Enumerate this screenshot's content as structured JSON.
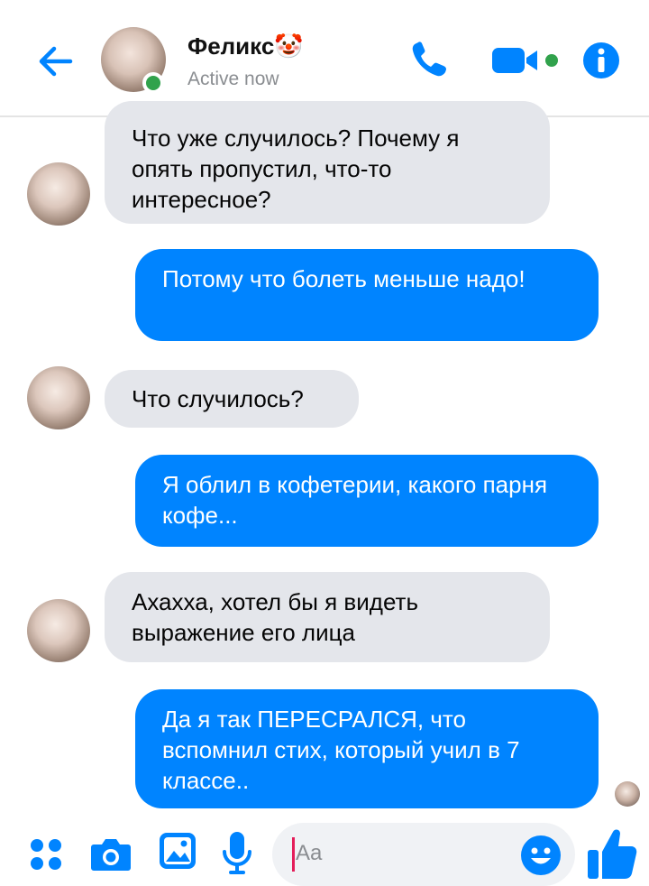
{
  "header": {
    "name": "Феликс🤡",
    "status": "Active now",
    "icons": [
      "back-arrow-icon",
      "phone-icon",
      "video-camera-icon",
      "info-icon"
    ],
    "accent_color": "#0084ff",
    "online_color": "#31a24c"
  },
  "messages": [
    {
      "direction": "in",
      "text": "Что уже случилось? Почему я опять пропустил, что-то интересное?"
    },
    {
      "direction": "out",
      "text": "Потому что болеть меньше надо!"
    },
    {
      "direction": "in",
      "text": "Что случилось?"
    },
    {
      "direction": "out",
      "text": "Я облил в кофетерии, какого парня кофе..."
    },
    {
      "direction": "in",
      "text": "Ахахха, хотел бы я видеть выражение его лица"
    },
    {
      "direction": "out",
      "text": "Да я так ПЕРЕСРАЛСЯ, что вспомнил стих, который учил в 7 классе.."
    }
  ],
  "composer": {
    "placeholder": "Aa",
    "icons": [
      "apps-icon",
      "camera-icon",
      "gallery-icon",
      "microphone-icon",
      "emoji-icon",
      "like-icon"
    ]
  }
}
